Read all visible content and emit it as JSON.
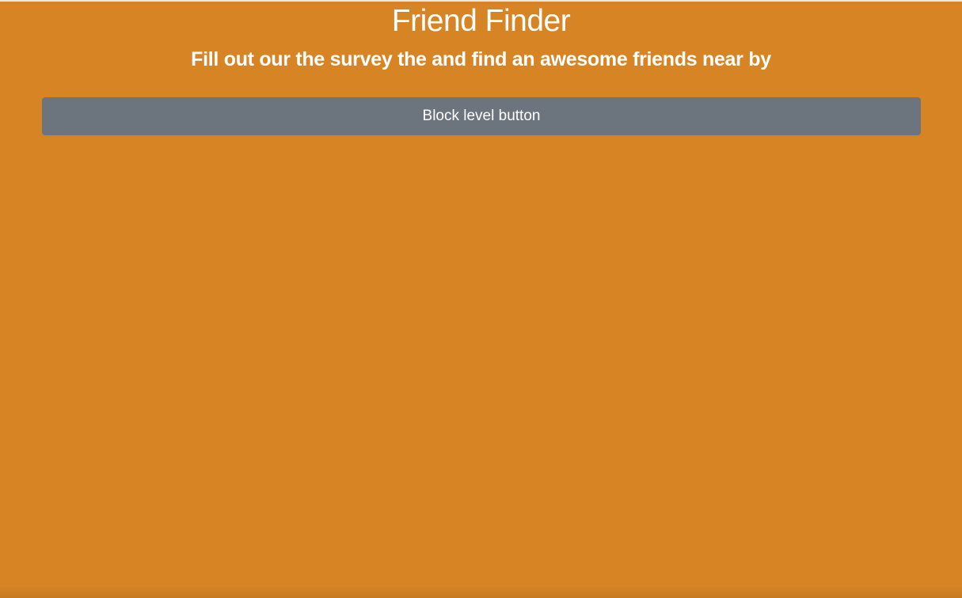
{
  "header": {
    "title": "Friend Finder",
    "subtitle": "Fill out our the survey the and find an awesome friends near by"
  },
  "main": {
    "button_label": "Block level button"
  },
  "colors": {
    "background": "#d68424",
    "button": "#6c757d",
    "text": "#ffffff"
  }
}
